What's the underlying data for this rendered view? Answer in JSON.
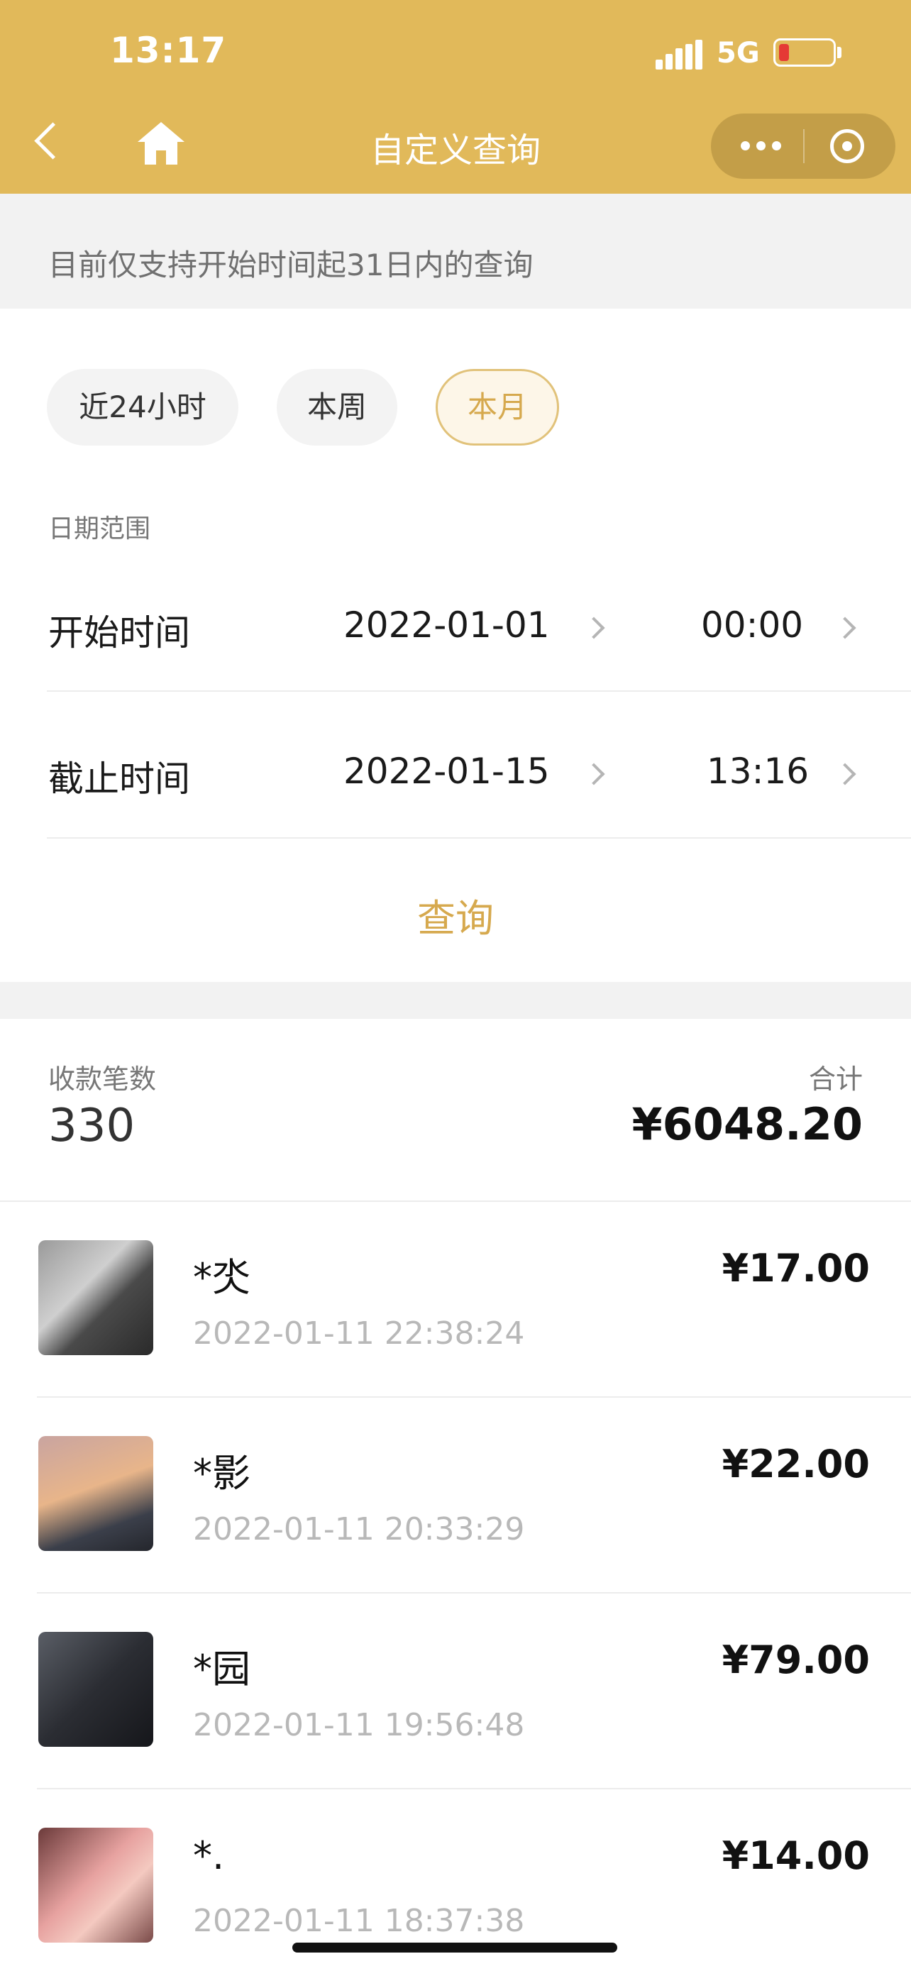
{
  "status_bar": {
    "time": "13:17",
    "network": "5G"
  },
  "header": {
    "title": "自定义查询"
  },
  "notice": "目前仅支持开始时间起31日内的查询",
  "quick_ranges": [
    "近24小时",
    "本周",
    "本月"
  ],
  "quick_range_selected": "本月",
  "date_range": {
    "label": "日期范围",
    "start": {
      "label": "开始时间",
      "date": "2022-01-01",
      "time": "00:00"
    },
    "end": {
      "label": "截止时间",
      "date": "2022-01-15",
      "time": "13:16"
    }
  },
  "query_button": "查询",
  "summary": {
    "count_label": "收款笔数",
    "count": "330",
    "total_label": "合计",
    "total": "¥6048.20"
  },
  "transactions": [
    {
      "name": "*氼",
      "time": "2022-01-11 22:38:24",
      "amount": "¥17.00"
    },
    {
      "name": "*影",
      "time": "2022-01-11 20:33:29",
      "amount": "¥22.00"
    },
    {
      "name": "*园",
      "time": "2022-01-11 19:56:48",
      "amount": "¥79.00"
    },
    {
      "name": "*.",
      "time": "2022-01-11 18:37:38",
      "amount": "¥14.00"
    }
  ],
  "colors": {
    "header": "#e1b95a",
    "accent": "#d6a94e",
    "chip_active_bg": "#fdf6e8",
    "battery_low": "#e53935"
  },
  "icons": [
    "back-icon",
    "home-icon",
    "more-dots-icon",
    "close-target-icon",
    "chevron-right-icon"
  ]
}
